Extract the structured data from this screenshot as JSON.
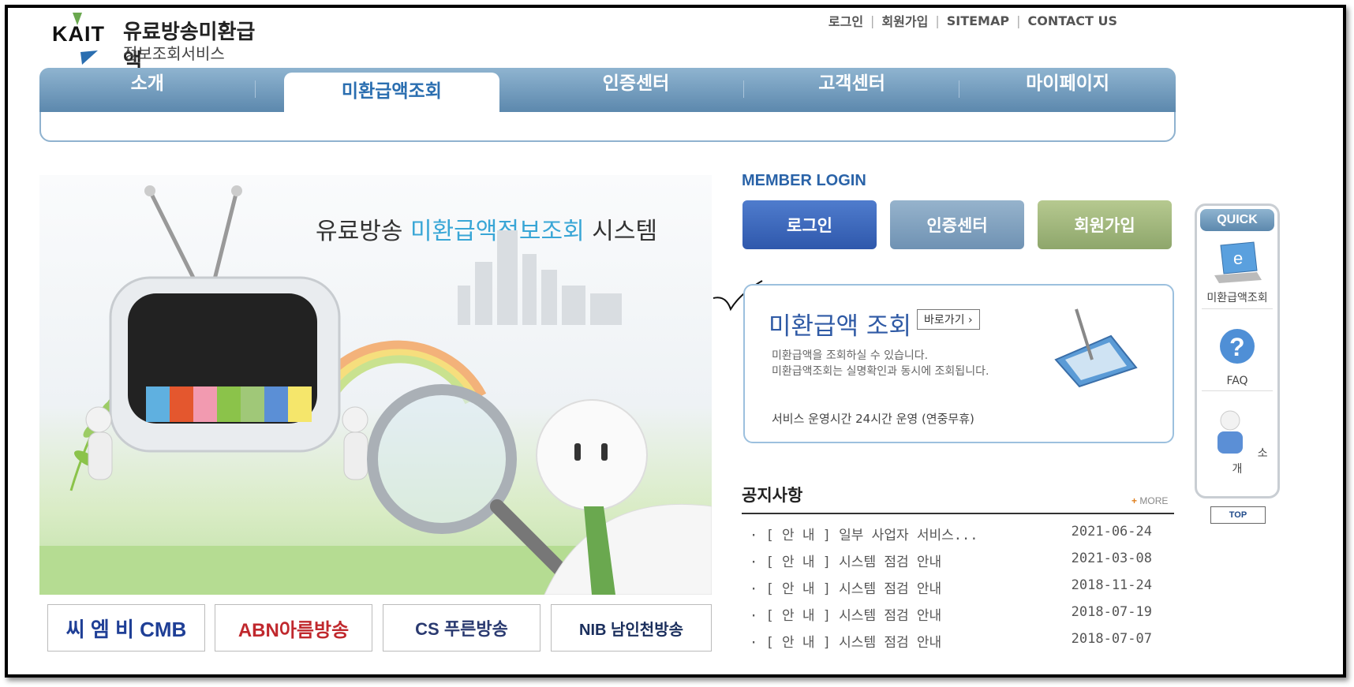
{
  "header": {
    "logo_text": "KAIT",
    "service_name_1": "유료방송미환급액",
    "service_name_2": "정보조회서비스",
    "top_links": [
      "로그인",
      "회원가입",
      "SITEMAP",
      "CONTACT US"
    ]
  },
  "gnb": [
    "소개",
    "미환급액조회",
    "인증센터",
    "고객센터",
    "마이페이지"
  ],
  "hero": {
    "title_before": "유료방송 ",
    "title_highlight": "미환급액정보조회",
    "title_after": " 시스템"
  },
  "partners": [
    "씨 엠 비 CMB",
    "ABN아름방송",
    "CS 푸른방송",
    "NIB 남인천방송"
  ],
  "login": {
    "heading": "MEMBER LOGIN",
    "login_label": "로그인",
    "cert_label": "인증센터",
    "join_label": "회원가입"
  },
  "lookup": {
    "title": "미환급액 조회",
    "go_label": "바로가기 ›",
    "desc1": "미환급액을 조회하실 수 있습니다.",
    "desc2": "미환급액조회는 실명확인과 동시에 조회됩니다.",
    "hours": "서비스 운영시간   24시간 운영 (연중무휴)"
  },
  "notice": {
    "title": "공지사항",
    "more": "MORE",
    "items": [
      {
        "title": "· [ 안 내 ] 일부 사업자 서비스...",
        "date": "2021-06-24"
      },
      {
        "title": "· [ 안 내 ] 시스템 점검 안내",
        "date": "2021-03-08"
      },
      {
        "title": "· [ 안 내 ] 시스템 점검 안내",
        "date": "2018-11-24"
      },
      {
        "title": "· [ 안 내 ] 시스템 점검 안내",
        "date": "2018-07-19"
      },
      {
        "title": "· [ 안 내 ] 시스템 점검 안내",
        "date": "2018-07-07"
      }
    ]
  },
  "quick": {
    "heading": "QUICK",
    "items": [
      "미환급액조회",
      "FAQ",
      "소개"
    ],
    "top": "TOP"
  }
}
